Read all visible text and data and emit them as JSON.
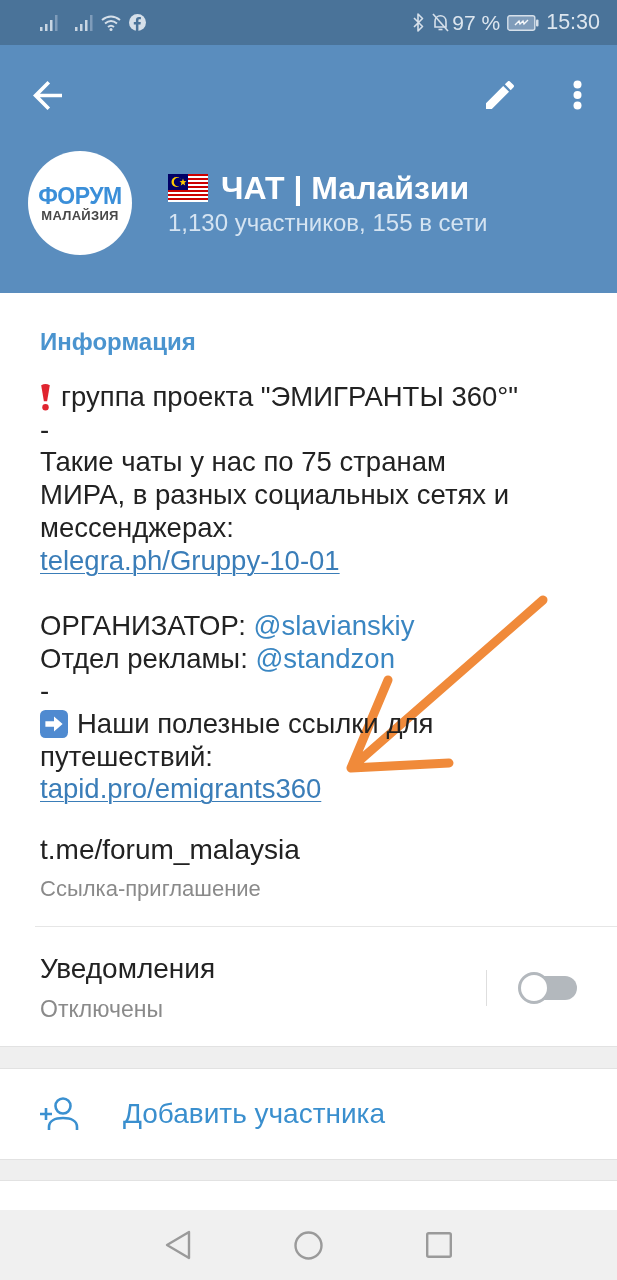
{
  "status_bar": {
    "battery": "97 %",
    "time": "15:30"
  },
  "header": {
    "avatar": {
      "title": "ФОРУМ",
      "subtitle": "МАЛАЙЗИЯ"
    },
    "title": "ЧАТ | Малайзии",
    "subtitle": "1,130 участников, 155 в сети"
  },
  "info": {
    "heading": "Информация",
    "paragraphs": [
      [
        {
          "kind": "alert",
          "lines": [
            "группа проекта \"ЭМИГРАНТЫ 360°\""
          ]
        },
        {
          "kind": "text",
          "lines": [
            "-"
          ]
        },
        {
          "kind": "text",
          "lines": [
            "Такие чаты у нас по 75 странам",
            "МИРА, в разных социальных сетях и",
            "мессенджерах:"
          ]
        },
        {
          "kind": "link",
          "text": "telegra.ph/Gruppy-10-01"
        }
      ],
      [
        {
          "kind": "mention",
          "label": "ОРГАНИЗАТОР:",
          "mention": "@slavianskiy"
        },
        {
          "kind": "mention",
          "label": "Отдел рекламы:",
          "mention": "@standzon"
        },
        {
          "kind": "text",
          "lines": [
            "-"
          ]
        },
        {
          "kind": "pointer",
          "lines": [
            "Наши полезные ссылки для",
            "путешествий:"
          ]
        },
        {
          "kind": "link",
          "text": "tapid.pro/emigrants360"
        }
      ]
    ],
    "invite_link": {
      "value": "t.me/forum_malaysia",
      "label": "Ссылка-приглашение"
    }
  },
  "notifications": {
    "label": "Уведомления",
    "status": "Отключены",
    "on": false
  },
  "actions": [
    {
      "label": "Добавить участника"
    }
  ],
  "annotations": [
    {
      "kind": "arrow"
    }
  ]
}
